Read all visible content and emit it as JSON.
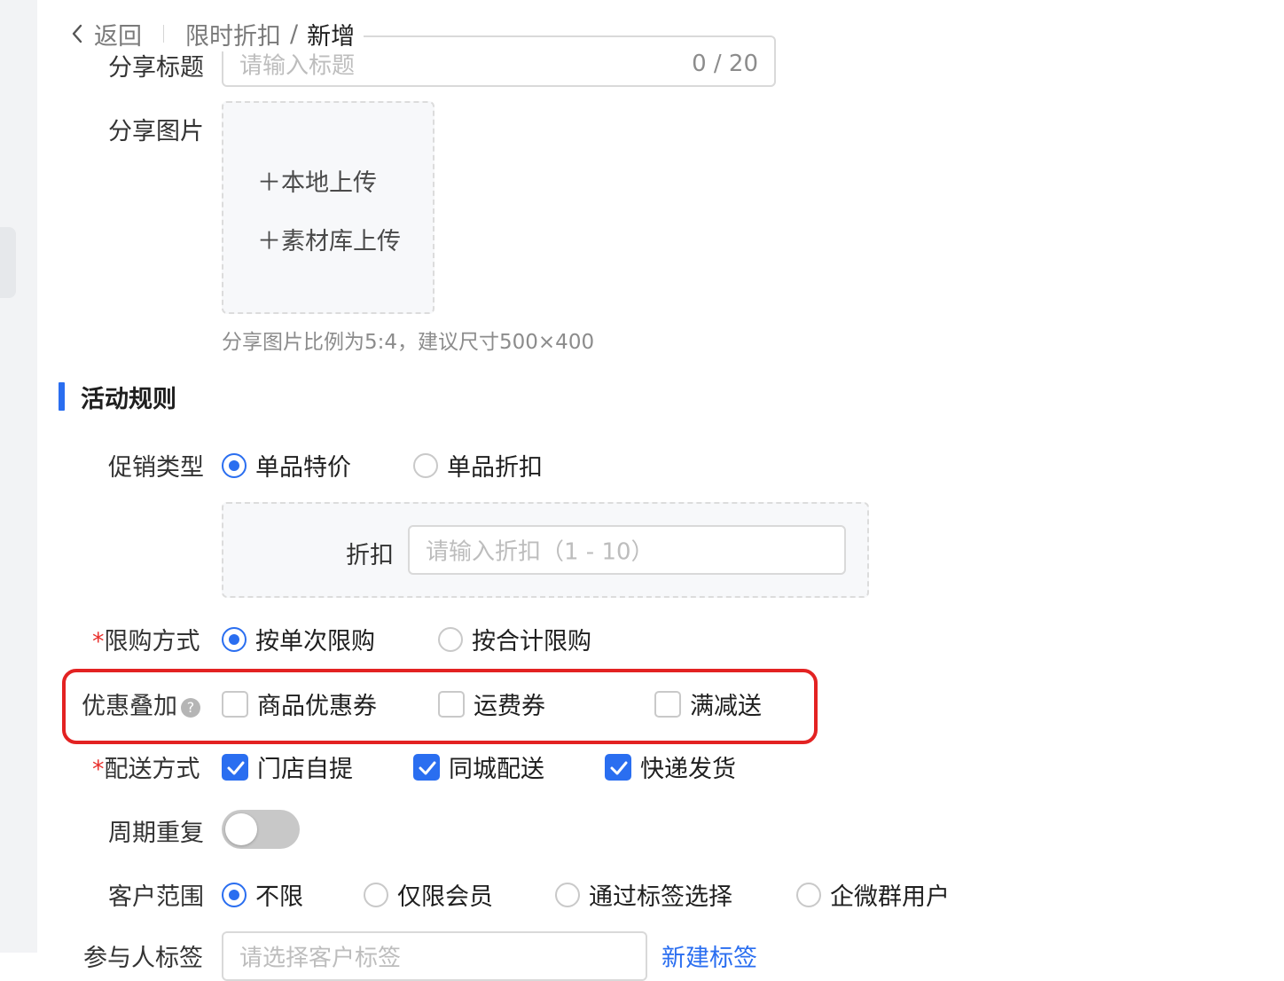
{
  "header": {
    "back_label": "返回",
    "breadcrumb_parent": "限时折扣",
    "breadcrumb_separator": "/",
    "breadcrumb_current": "新增"
  },
  "share": {
    "title_label": "分享标题",
    "title_placeholder": "请输入标题",
    "title_counter": "0 / 20",
    "image_label": "分享图片",
    "upload_local": "＋本地上传",
    "upload_library": "＋素材库上传",
    "image_hint": "分享图片比例为5:4，建议尺寸500×400"
  },
  "rules": {
    "section_title": "活动规则",
    "promo_type": {
      "label": "促销类型",
      "options": [
        "单品特价",
        "单品折扣"
      ],
      "selected": "单品特价"
    },
    "discount": {
      "label": "折扣",
      "placeholder": "请输入折扣（1 - 10）"
    },
    "limit_method": {
      "required_mark": "*",
      "label": "限购方式",
      "options": [
        "按单次限购",
        "按合计限购"
      ],
      "selected": "按单次限购"
    },
    "stacking": {
      "label": "优惠叠加",
      "help": "?",
      "options": [
        "商品优惠券",
        "运费券",
        "满减送"
      ],
      "checked": []
    },
    "delivery": {
      "required_mark": "*",
      "label": "配送方式",
      "options": [
        "门店自提",
        "同城配送",
        "快递发货"
      ],
      "checked": [
        "门店自提",
        "同城配送",
        "快递发货"
      ]
    },
    "repeat": {
      "label": "周期重复",
      "enabled": false
    },
    "customer_scope": {
      "label": "客户范围",
      "options": [
        "不限",
        "仅限会员",
        "通过标签选择",
        "企微群用户"
      ],
      "selected": "不限"
    },
    "participant_tag": {
      "label": "参与人标签",
      "placeholder": "请选择客户标签",
      "new_tag_link": "新建标签"
    }
  },
  "colors": {
    "accent": "#2a6ef0",
    "highlight": "#e32222",
    "required": "#e8312e"
  }
}
